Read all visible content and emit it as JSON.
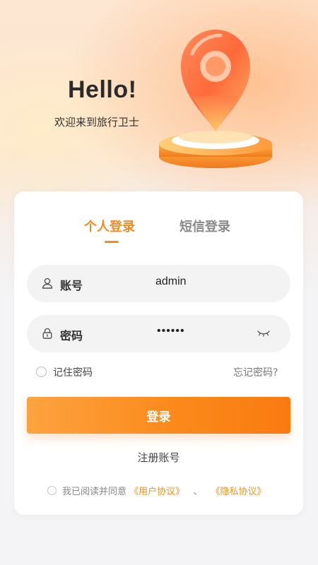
{
  "hero": {
    "title": "Hello!",
    "subtitle": "欢迎来到旅行卫士"
  },
  "tabs": [
    {
      "label": "个人登录",
      "active": true
    },
    {
      "label": "短信登录",
      "active": false
    }
  ],
  "username": {
    "label": "账号",
    "value": "admin",
    "icon": "user-icon"
  },
  "password": {
    "label": "密码",
    "value": "••••••",
    "icon": "lock-icon",
    "toggle_icon": "eye-closed-icon"
  },
  "remember": {
    "label": "记住密码",
    "checked": false
  },
  "forgot": {
    "label": "忘记密码?"
  },
  "login_button": {
    "label": "登录"
  },
  "register": {
    "label": "注册账号"
  },
  "agreement": {
    "checked": false,
    "prefix": "我已阅读并同意",
    "user_agreement": "《用户协议》",
    "separator": "、",
    "privacy_policy": "《隐私协议》"
  },
  "colors": {
    "accent": "#f58a1f",
    "button_start": "#fca340",
    "button_end": "#fa7a10",
    "field_bg": "#f3f3f3",
    "page_bg": "#f4f4f6"
  }
}
